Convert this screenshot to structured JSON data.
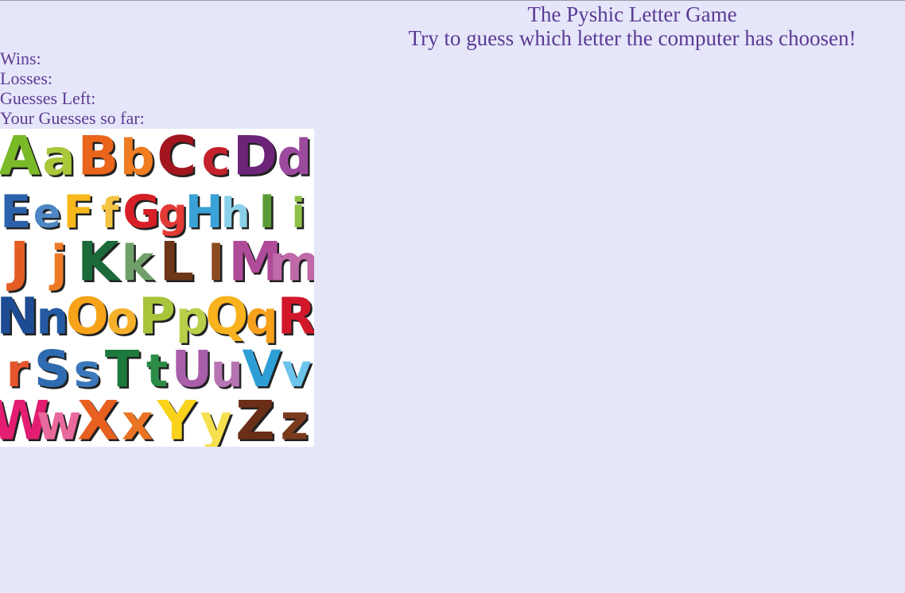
{
  "header": {
    "title": "The Pyshic Letter Game",
    "subtitle": "Try to guess which letter the computer has choosen!"
  },
  "stats": {
    "wins_label": "Wins:",
    "losses_label": "Losses:",
    "guesses_left_label": "Guesses Left:",
    "guesses_so_far_label": "Your Guesses so far:"
  },
  "alphabet_image": {
    "rows": [
      [
        {
          "ch": "A",
          "color": "#7ab928"
        },
        {
          "ch": "a",
          "color": "#a9c83a"
        },
        {
          "ch": "B",
          "color": "#e8651b"
        },
        {
          "ch": "b",
          "color": "#f07d22"
        },
        {
          "ch": "C",
          "color": "#a3151f"
        },
        {
          "ch": "c",
          "color": "#c5212c"
        },
        {
          "ch": "D",
          "color": "#6b2478"
        },
        {
          "ch": "d",
          "color": "#9b4a9e"
        }
      ],
      [
        {
          "ch": "E",
          "color": "#2c62ac"
        },
        {
          "ch": "e",
          "color": "#4d86c4"
        },
        {
          "ch": "F",
          "color": "#f6b81c"
        },
        {
          "ch": "f",
          "color": "#f5c342"
        },
        {
          "ch": "G",
          "color": "#d81f27"
        },
        {
          "ch": "g",
          "color": "#e23a35"
        },
        {
          "ch": "H",
          "color": "#3aa2d6"
        },
        {
          "ch": "h",
          "color": "#8ad0e8"
        },
        {
          "ch": "I",
          "color": "#5a9b35"
        },
        {
          "ch": "i",
          "color": "#8cc046"
        }
      ],
      [
        {
          "ch": "J",
          "color": "#e35d23"
        },
        {
          "ch": "j",
          "color": "#ef7a26"
        },
        {
          "ch": "K",
          "color": "#1b6b3a"
        },
        {
          "ch": "k",
          "color": "#6fa06a"
        },
        {
          "ch": "L",
          "color": "#6d3618"
        },
        {
          "ch": "l",
          "color": "#8b4a22"
        },
        {
          "ch": "M",
          "color": "#b04b9a"
        },
        {
          "ch": "m",
          "color": "#c06aa9"
        }
      ],
      [
        {
          "ch": "N",
          "color": "#1d4c92"
        },
        {
          "ch": "n",
          "color": "#245aa3"
        },
        {
          "ch": "O",
          "color": "#f6a319"
        },
        {
          "ch": "o",
          "color": "#f6b12b"
        },
        {
          "ch": "P",
          "color": "#a7c43b"
        },
        {
          "ch": "p",
          "color": "#b9cf4a"
        },
        {
          "ch": "Q",
          "color": "#f7b21d"
        },
        {
          "ch": "q",
          "color": "#f6a01c"
        },
        {
          "ch": "R",
          "color": "#d0182a"
        }
      ],
      [
        {
          "ch": "r",
          "color": "#e7552c"
        },
        {
          "ch": "S",
          "color": "#2e6bb0"
        },
        {
          "ch": "s",
          "color": "#3b78bb"
        },
        {
          "ch": "T",
          "color": "#1c7a3d"
        },
        {
          "ch": "t",
          "color": "#2b8c48"
        },
        {
          "ch": "U",
          "color": "#a85ea8"
        },
        {
          "ch": "u",
          "color": "#b674b3"
        },
        {
          "ch": "V",
          "color": "#2e9fd6"
        },
        {
          "ch": "v",
          "color": "#6cc4ea"
        }
      ],
      [
        {
          "ch": "W",
          "color": "#e31d72"
        },
        {
          "ch": "w",
          "color": "#e8699b"
        },
        {
          "ch": "X",
          "color": "#e8601f"
        },
        {
          "ch": "x",
          "color": "#ea7324"
        },
        {
          "ch": "Y",
          "color": "#f9d21c"
        },
        {
          "ch": "y",
          "color": "#f6e04f"
        },
        {
          "ch": "Z",
          "color": "#6b2e16"
        },
        {
          "ch": "z",
          "color": "#7a3a1d"
        }
      ]
    ]
  }
}
